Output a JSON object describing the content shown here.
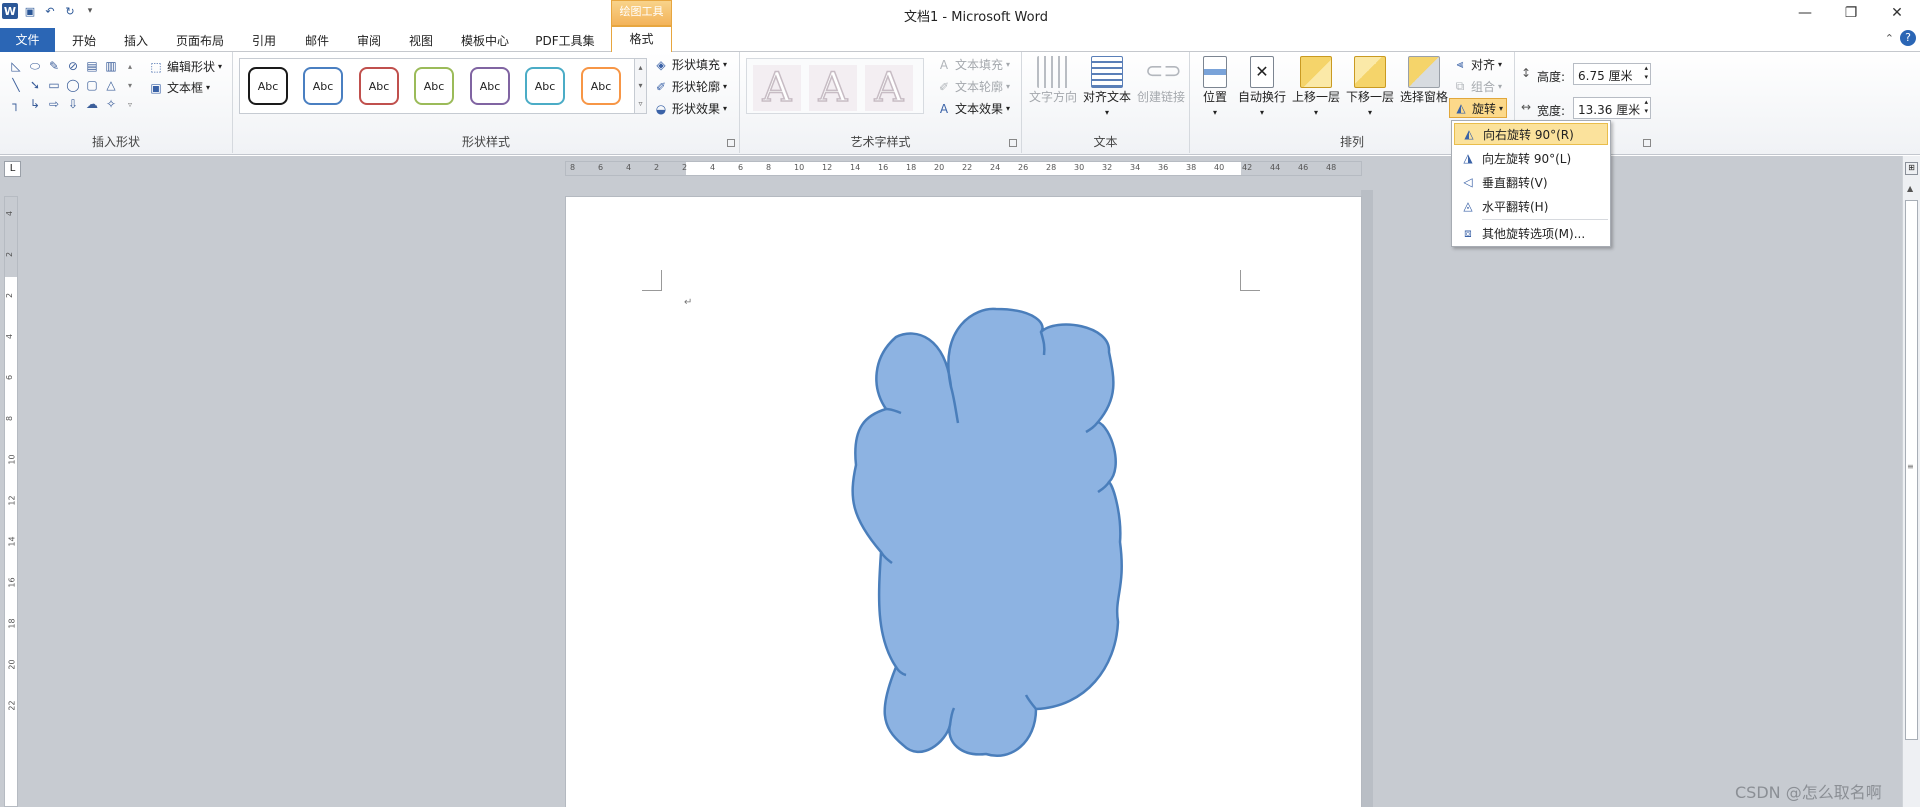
{
  "app": {
    "title": "文档1 - Microsoft Word"
  },
  "qat": {
    "icons": [
      "word-logo-icon",
      "save-icon",
      "undo-icon",
      "redo-icon",
      "customize-icon"
    ]
  },
  "tabs": [
    {
      "label": "文件"
    },
    {
      "label": "开始"
    },
    {
      "label": "插入"
    },
    {
      "label": "页面布局"
    },
    {
      "label": "引用"
    },
    {
      "label": "邮件"
    },
    {
      "label": "审阅"
    },
    {
      "label": "视图"
    },
    {
      "label": "模板中心"
    },
    {
      "label": "PDF工具集"
    },
    {
      "label": "格式"
    }
  ],
  "context_tab_header": "绘图工具",
  "ribbon": {
    "insert_shapes": {
      "label": "插入形状",
      "edit_shape": "编辑形状",
      "text_box": "文本框"
    },
    "shape_styles": {
      "label": "形状样式",
      "swatch_text": "Abc",
      "swatch_colors": [
        "#1a1a1a",
        "#4a7fc1",
        "#c0504d",
        "#9bbb59",
        "#8064a2",
        "#4bacc6",
        "#f79646"
      ],
      "fill": "形状填充",
      "outline": "形状轮廓",
      "effects": "形状效果"
    },
    "wordart": {
      "label": "艺术字样式",
      "text_fill": "文本填充",
      "text_outline": "文本轮廓",
      "text_effects": "文本效果",
      "letter": "A"
    },
    "text": {
      "label": "文本",
      "direction": "文字方向",
      "align": "对齐文本",
      "link": "创建链接"
    },
    "arrange": {
      "label": "排列",
      "position": "位置",
      "wrap": "自动换行",
      "forward": "上移一层",
      "backward": "下移一层",
      "selection_pane": "选择窗格",
      "align": "对齐",
      "group": "组合",
      "rotate": "旋转"
    },
    "size": {
      "height_label": "高度:",
      "height_value": "6.75 厘米",
      "width_label": "宽度:",
      "width_value": "13.36 厘米"
    }
  },
  "rotate_menu": [
    {
      "label": "向右旋转 90°(R)",
      "icon": "rotate-right-icon"
    },
    {
      "label": "向左旋转 90°(L)",
      "icon": "rotate-left-icon"
    },
    {
      "label": "垂直翻转(V)",
      "icon": "flip-vertical-icon"
    },
    {
      "label": "水平翻转(H)",
      "icon": "flip-horizontal-icon"
    },
    {
      "label": "其他旋转选项(M)...",
      "icon": "more-rotation-icon"
    }
  ],
  "ruler": {
    "h_ticks": [
      "8",
      "6",
      "4",
      "2",
      "2",
      "4",
      "6",
      "8",
      "10",
      "12",
      "14",
      "16",
      "18",
      "20",
      "22",
      "24",
      "26",
      "28",
      "30",
      "32",
      "34",
      "36",
      "38",
      "40",
      "42",
      "44",
      "46",
      "48"
    ],
    "v_ticks": [
      "4",
      "2",
      "2",
      "4",
      "6",
      "8",
      "10",
      "12",
      "14",
      "16",
      "18",
      "20",
      "22"
    ]
  },
  "document": {
    "paragraph_mark": "↵",
    "shape_fill": "#8db3e2",
    "shape_stroke": "#4a7ebb"
  },
  "watermark": "CSDN @怎么取名啊"
}
